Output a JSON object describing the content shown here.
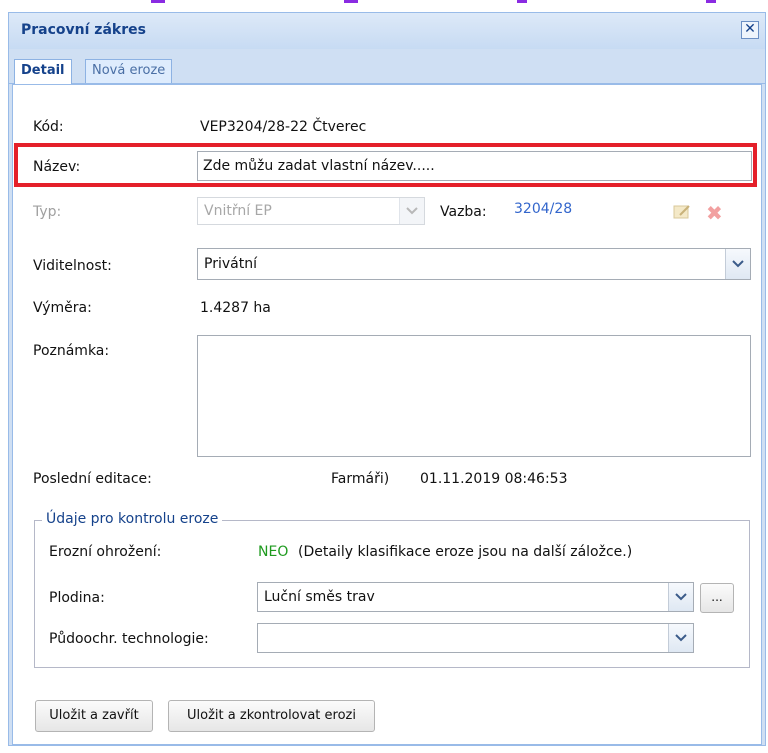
{
  "window": {
    "title": "Pracovní zákres",
    "close_icon": "close-icon"
  },
  "tabs": [
    {
      "label": "Detail",
      "active": true
    },
    {
      "label": "Nová eroze",
      "active": false
    }
  ],
  "fields": {
    "kod": {
      "label": "Kód:",
      "value": "VEP3204/28-22 Čtverec"
    },
    "nazev": {
      "label": "Název:",
      "value": "Zde můžu zadat vlastní název....."
    },
    "typ": {
      "label": "Typ:",
      "value": "Vnitřní EP",
      "disabled": true
    },
    "vazba": {
      "label": "Vazba:",
      "value": "3204/28"
    },
    "viditelnost": {
      "label": "Viditelnost:",
      "value": "Privátní"
    },
    "vymera": {
      "label": "Výměra:",
      "value": "1.4287 ha"
    },
    "poznamka": {
      "label": "Poznámka:",
      "value": ""
    },
    "posledni_editace": {
      "label": "Poslední editace:",
      "author": "Farmáři)",
      "datetime": "01.11.2019 08:46:53"
    }
  },
  "eroze": {
    "legend": "Údaje pro kontrolu eroze",
    "ohrozeni_label": "Erozní ohrožení:",
    "ohrozeni_value": "NEO",
    "ohrozeni_note": "(Detaily klasifikace eroze jsou na další záložce.)",
    "ohrozeni_color": "#1e9a1e",
    "plodina_label": "Plodina:",
    "plodina_value": "Luční směs trav",
    "plodina_more": "...",
    "technologie_label": "Půdoochr. technologie:",
    "technologie_value": ""
  },
  "buttons": {
    "save_close": "Uložit a zavřít",
    "save_check": "Uložit a zkontrolovat erozi"
  },
  "colors": {
    "title": "#15428b",
    "highlight": "#e4202a",
    "vazba_link": "#3366cc"
  }
}
